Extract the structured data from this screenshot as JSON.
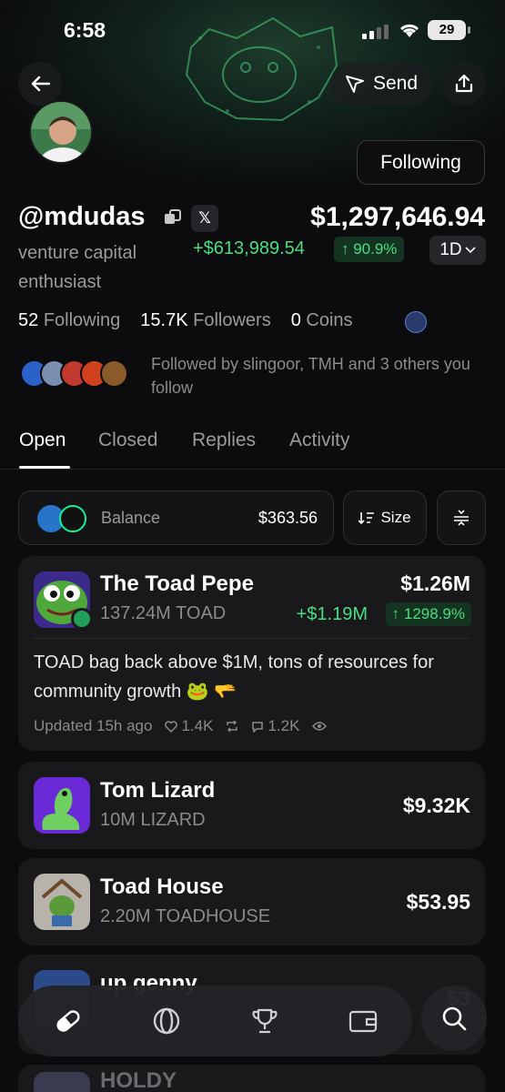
{
  "status": {
    "time": "6:58",
    "battery": "29"
  },
  "header": {
    "send_label": "Send"
  },
  "profile": {
    "following_button": "Following",
    "handle": "@mdudas",
    "x_badge": "𝕏",
    "bio": "venture capital enthusiast",
    "portfolio_value": "$1,297,646.94",
    "pnl": "+$613,989.54",
    "pnl_pct": "↑ 90.9%",
    "range": "1D",
    "stats": {
      "following_count": "52",
      "following_label": "Following",
      "followers_count": "15.7K",
      "followers_label": "Followers",
      "coins_count": "0",
      "coins_label": "Coins"
    },
    "followed_by": "Followed by slingoor, TMH and 3 others you follow"
  },
  "tabs": [
    "Open",
    "Closed",
    "Replies",
    "Activity"
  ],
  "balance": {
    "label": "Balance",
    "value": "$363.56",
    "sort_label": "Size"
  },
  "holdings": [
    {
      "name": "The Toad Pepe",
      "amount": "137.24M TOAD",
      "value": "$1.26M",
      "pnl": "+$1.19M",
      "pnl_pct": "↑ 1298.9%",
      "post": "TOAD bag back above $1M, tons of resources for community growth 🐸 🫳",
      "updated": "Updated 15h ago",
      "likes": "1.4K",
      "comments": "1.2K"
    },
    {
      "name": "Tom Lizard",
      "amount": "10M LIZARD",
      "value": "$9.32K"
    },
    {
      "name": "Toad House",
      "amount": "2.20M TOADHOUSE",
      "value": "$53.95"
    },
    {
      "name": "up genny",
      "amount": "",
      "value": "$3"
    },
    {
      "name": "HOLDY"
    }
  ],
  "colors": {
    "accent_green": "#4ade80",
    "background": "#0c0c0e",
    "card": "#19191c"
  },
  "icons": [
    "back-arrow-icon",
    "send-icon",
    "share-icon",
    "copy-icon",
    "globe-icon",
    "sort-icon",
    "filter-icon",
    "pill-icon",
    "circle-icon",
    "trophy-icon",
    "wallet-icon",
    "search-icon"
  ]
}
